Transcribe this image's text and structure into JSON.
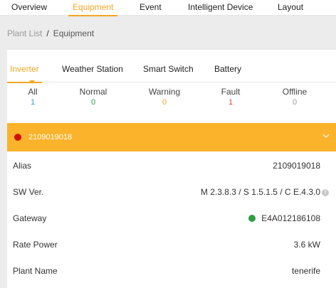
{
  "topnav": {
    "tabs": [
      "Overview",
      "Equipment",
      "Event",
      "Intelligent Device",
      "Layout"
    ],
    "active": "Equipment",
    "accent": "#f5a623"
  },
  "breadcrumb": {
    "parent": "Plant List",
    "separator": "/",
    "current": "Equipment"
  },
  "device_tabs": [
    "Inverter",
    "Weather Station",
    "Smart Switch",
    "Battery"
  ],
  "status_filters": [
    {
      "label": "All",
      "count": "1",
      "color": "#2b9fe0"
    },
    {
      "label": "Normal",
      "count": "0",
      "color": "#2e9e44"
    },
    {
      "label": "Warning",
      "count": "0",
      "color": "#f5a623"
    },
    {
      "label": "Fault",
      "count": "1",
      "color": "#e04848"
    },
    {
      "label": "Offline",
      "count": "0",
      "color": "#999999"
    }
  ],
  "device": {
    "serial": "2109019018",
    "status_color": "#d20f0f",
    "bar_color": "#fbb32b",
    "details": [
      {
        "key": "Alias",
        "value": "2109019018"
      },
      {
        "key": "SW Ver.",
        "value": "M 2.3.8.3 / S  1.5.1.5 / C E.4.3.0",
        "icon": "info-icon"
      },
      {
        "key": "Gateway",
        "value": "E4A012186108",
        "status": "online",
        "status_color": "#2e9e44"
      },
      {
        "key": "Rate Power",
        "value": "3.6 kW"
      },
      {
        "key": "Plant Name",
        "value": "tenerife"
      }
    ]
  }
}
